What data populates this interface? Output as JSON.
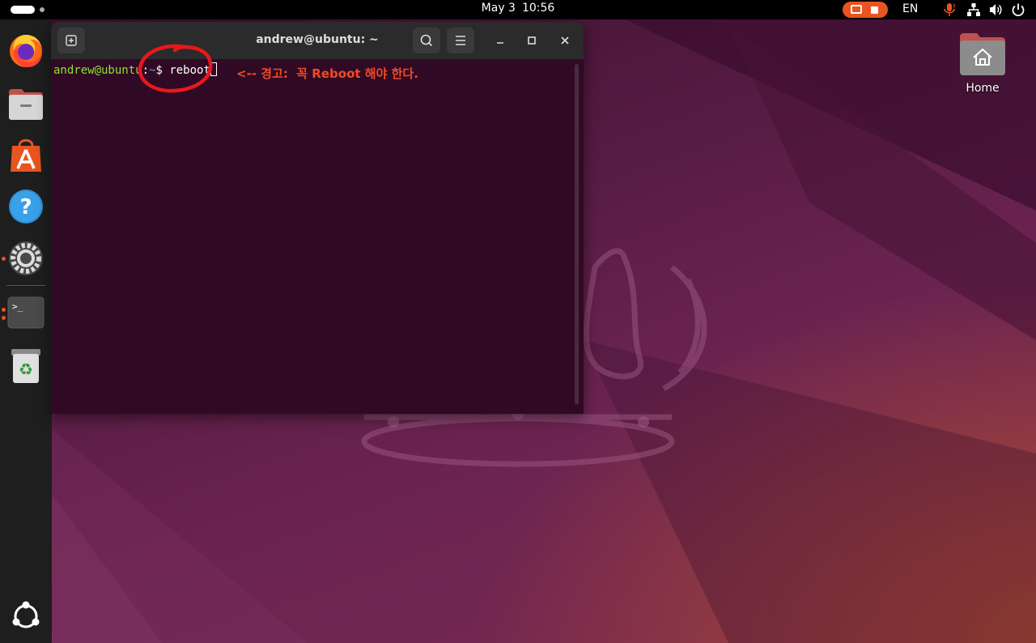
{
  "topbar": {
    "clock_date": "May 3",
    "clock_time": "10:56",
    "language": "EN",
    "tray_icons": [
      "screen-share-icon",
      "stop-recording-icon",
      "microphone-icon",
      "network-icon",
      "volume-icon",
      "power-icon"
    ]
  },
  "dock": {
    "items": [
      {
        "name": "firefox",
        "icon": "firefox-icon",
        "running": false
      },
      {
        "name": "files",
        "icon": "files-icon",
        "running": false
      },
      {
        "name": "app-center",
        "icon": "app-center-icon",
        "running": false
      },
      {
        "name": "help",
        "icon": "help-icon",
        "running": false
      },
      {
        "name": "settings",
        "icon": "settings-icon",
        "running": true
      },
      {
        "name": "terminal",
        "icon": "terminal-icon",
        "running": true
      },
      {
        "name": "trash",
        "icon": "trash-icon",
        "running": false
      }
    ],
    "show_apps_icon": "show-apps-icon"
  },
  "desktop": {
    "home_label": "Home"
  },
  "terminal": {
    "title": "andrew@ubuntu: ~",
    "prompt_user": "andrew@ubuntu",
    "prompt_sep": ":",
    "prompt_path": "~",
    "prompt_symbol": "$",
    "command": "reboot"
  },
  "annotation": {
    "text": "<-- 경고:  꼭 Reboot 해야 한다.",
    "color": "#f04a28"
  },
  "colors": {
    "accent": "#e95420",
    "terminal_bg": "#300a24",
    "prompt_user": "#8ae234",
    "prompt_path": "#729fcf"
  }
}
